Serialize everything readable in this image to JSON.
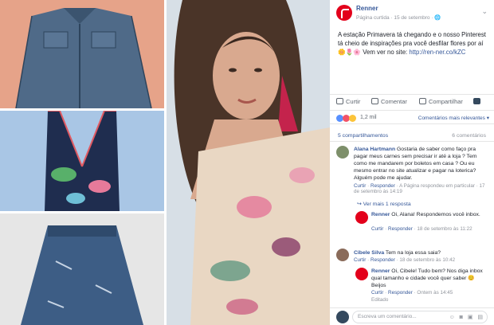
{
  "post": {
    "page_name": "Renner",
    "meta": "Página curtida · 15 de setembro · ",
    "globe": "🌐",
    "chevron": "⌄",
    "text_main": "A estação Primavera tá chegando e o nosso Pinterest tá cheio de inspirações pra você desfilar flores por aí 🌼🌷🌸 Vem ver no site: ",
    "text_link": "http://ren-ner.co/kZC"
  },
  "actions": {
    "like": "Curtir",
    "comment": "Comentar",
    "share": "Compartilhar"
  },
  "reactions": {
    "count": "1,2 mil",
    "relevance": "Comentários mais relevantes ▾",
    "shares": "5 compartilhamentos",
    "comments_count": "6 comentários"
  },
  "comments": [
    {
      "name": "Alana Hartmann",
      "text": " Gostaria de saber como faço pra pagar meus carnes sem precisar ir até a loja ? Tem como me mandarem por boletos em casa ? Ou eu mesmo entrar no site atualizar e pagar na loterica? Alguém pode me ajudar.",
      "like": "Curtir",
      "reply": "Responder",
      "extra": " · A Página respondeu em particular · 17 de setembro às 14:19"
    },
    {
      "name": "Renner",
      "text": " Oi, Alana! Respondemos você inbox. ",
      "like": "Curtir",
      "reply": "Responder",
      "extra": " · 18 de setembro às 11:22"
    },
    {
      "name": "Cibele Silva",
      "text": " Tem na loja essa saia?",
      "like": "Curtir",
      "reply": "Responder",
      "extra": " · 18 de setembro às 10:42"
    },
    {
      "name": "Renner",
      "text": " Oi, Cibele! Tudo bem? Nos diga inbox qual tamanho e cidade você quer saber 😊 Beijos",
      "like": "Curtir",
      "reply": "Responder",
      "extra": " · Ontem às 14:45",
      "edited": "Editado"
    }
  ],
  "view_replies": "↪ Ver mais 1 resposta",
  "composer": {
    "placeholder": "Escreva um comentário...",
    "icons": "☺ ◙ ▣ ▤"
  }
}
